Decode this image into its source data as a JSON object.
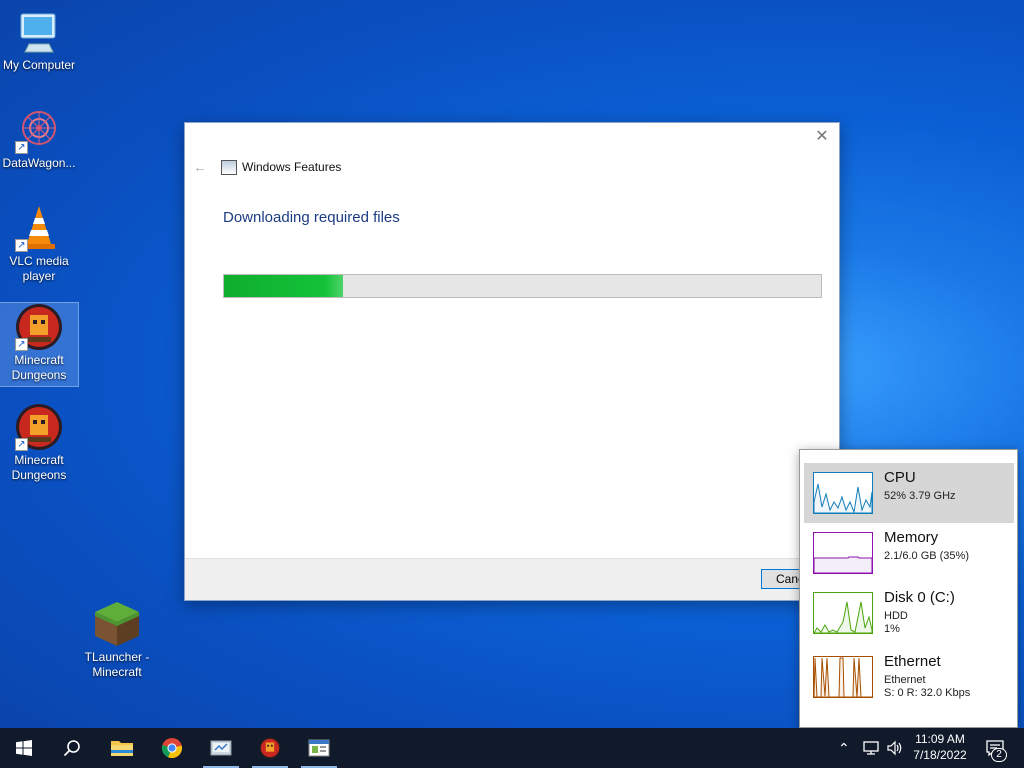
{
  "desktop": {
    "icons": [
      {
        "label": "My Computer",
        "icon": "monitor-icon"
      },
      {
        "label": "DataWagon...",
        "icon": "molecule-icon"
      },
      {
        "label": "VLC media player",
        "icon": "traffic-cone-icon"
      },
      {
        "label": "Minecraft Dungeons",
        "icon": "dungeons-emblem-icon"
      },
      {
        "label": "Minecraft Dungeons",
        "icon": "dungeons-emblem-icon"
      },
      {
        "label": "TLauncher - Minecraft",
        "icon": "grass-block-icon"
      }
    ]
  },
  "dialog": {
    "title": "Windows Features",
    "heading": "Downloading required files",
    "progress": 0.2,
    "cancel_label": "Cancel"
  },
  "perf": {
    "items": [
      {
        "name": "CPU",
        "line1": "52%  3.79 GHz",
        "line2": "",
        "color": "#117dbb"
      },
      {
        "name": "Memory",
        "line1": "2.1/6.0 GB (35%)",
        "line2": "",
        "color": "#8b12ae"
      },
      {
        "name": "Disk 0 (C:)",
        "line1": "HDD",
        "line2": "1%",
        "color": "#4da60c"
      },
      {
        "name": "Ethernet",
        "line1": "Ethernet",
        "line2": "S: 0  R: 32.0 Kbps",
        "color": "#a74f01"
      }
    ]
  },
  "taskbar": {
    "apps": [
      "start-icon",
      "search-icon",
      "file-explorer-icon",
      "chrome-icon",
      "control-panel-icon",
      "minecraft-dungeons-icon",
      "windows-features-icon"
    ],
    "time": "11:09 AM",
    "date": "7/18/2022",
    "notifications": "2"
  }
}
